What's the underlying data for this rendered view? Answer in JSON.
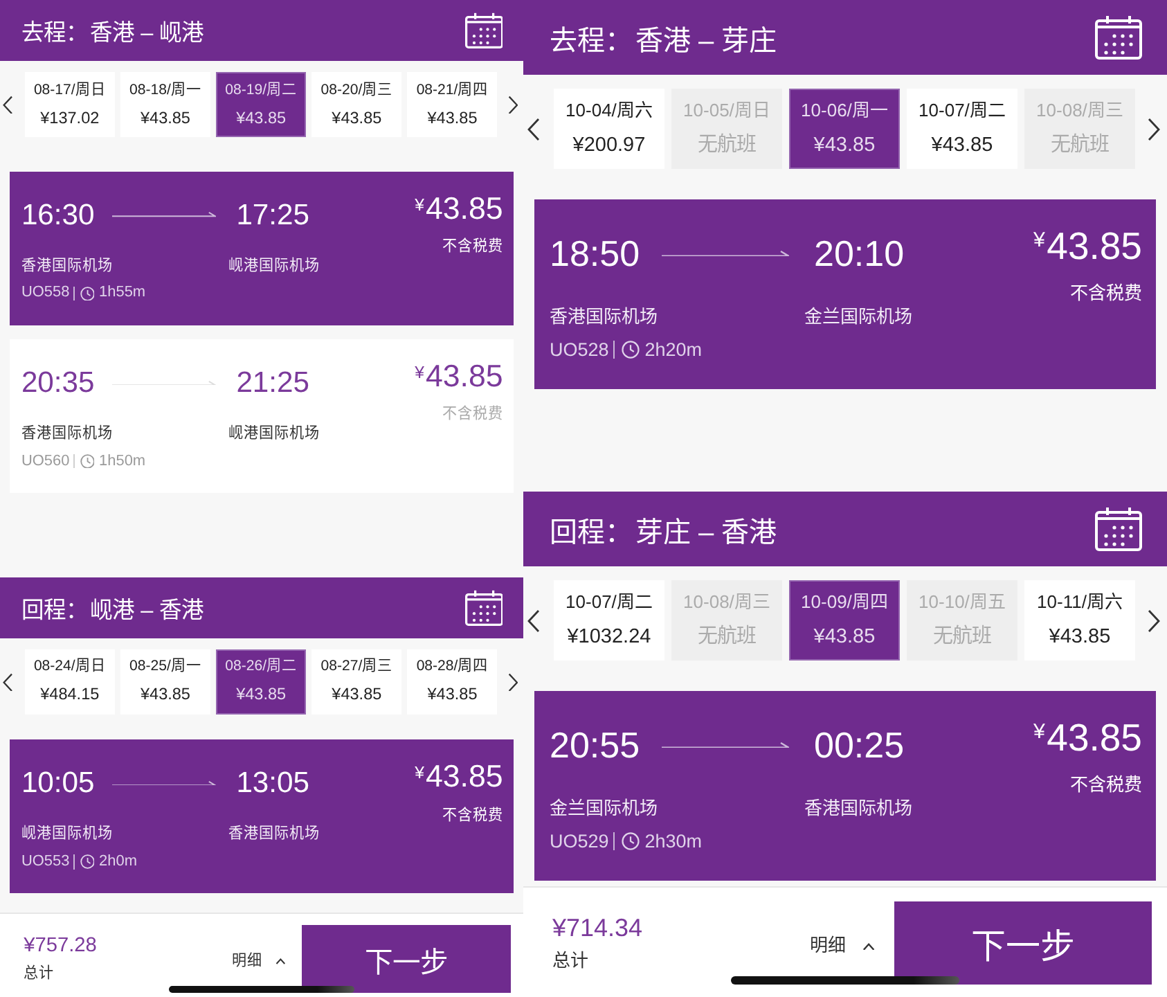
{
  "screens": [
    {
      "trips": [
        {
          "label": "去程：",
          "route": "香港 – 岘港",
          "dates": [
            {
              "date": "08-17/周日",
              "price": "¥137.02",
              "available": true,
              "selected": false
            },
            {
              "date": "08-18/周一",
              "price": "¥43.85",
              "available": true,
              "selected": false
            },
            {
              "date": "08-19/周二",
              "price": "¥43.85",
              "available": true,
              "selected": true
            },
            {
              "date": "08-20/周三",
              "price": "¥43.85",
              "available": true,
              "selected": false
            },
            {
              "date": "08-21/周四",
              "price": "¥43.85",
              "available": true,
              "selected": false
            }
          ],
          "flights": [
            {
              "depart": "16:30",
              "arrive": "17:25",
              "price": "$^{¥}$43.85",
              "tax_note": "不含税费",
              "from": "香港国际机场",
              "to": "岘港国际机场",
              "flight_no": "UO558",
              "duration": "1h55m",
              "selected": true
            },
            {
              "depart": "20:35",
              "arrive": "21:25",
              "price": "$^{¥}$43.85",
              "tax_note": "不含税费",
              "from": "香港国际机场",
              "to": "岘港国际机场",
              "flight_no": "UO560",
              "duration": "1h50m",
              "selected": false
            }
          ]
        },
        {
          "label": "回程：",
          "route": "岘港 – 香港",
          "dates": [
            {
              "date": "08-24/周日",
              "price": "¥484.15",
              "available": true,
              "selected": false
            },
            {
              "date": "08-25/周一",
              "price": "¥43.85",
              "available": true,
              "selected": false
            },
            {
              "date": "08-26/周二",
              "price": "¥43.85",
              "available": true,
              "selected": true
            },
            {
              "date": "08-27/周三",
              "price": "¥43.85",
              "available": true,
              "selected": false
            },
            {
              "date": "08-28/周四",
              "price": "¥43.85",
              "available": true,
              "selected": false
            }
          ],
          "flights": [
            {
              "depart": "10:05",
              "arrive": "13:05",
              "price": "$^{¥}$43.85",
              "tax_note": "不含税费",
              "from": "岘港国际机场",
              "to": "香港国际机场",
              "flight_no": "UO553",
              "duration": "2h0m",
              "selected": true
            }
          ]
        }
      ],
      "footer": {
        "total": "¥757.28",
        "total_label": "总计",
        "details": "明细",
        "next": "下一步"
      }
    },
    {
      "trips": [
        {
          "label": "去程：",
          "route": "香港 – 芽庄",
          "dates": [
            {
              "date": "10-04/周六",
              "price": "¥200.97",
              "available": true,
              "selected": false
            },
            {
              "date": "10-05/周日",
              "price": "无航班",
              "available": false,
              "selected": false
            },
            {
              "date": "10-06/周一",
              "price": "¥43.85",
              "available": true,
              "selected": true
            },
            {
              "date": "10-07/周二",
              "price": "¥43.85",
              "available": true,
              "selected": false
            },
            {
              "date": "10-08/周三",
              "price": "无航班",
              "available": false,
              "selected": false
            }
          ],
          "flights": [
            {
              "depart": "18:50",
              "arrive": "20:10",
              "price": "$^{¥}$43.85",
              "tax_note": "不含税费",
              "from": "香港国际机场",
              "to": "金兰国际机场",
              "flight_no": "UO528",
              "duration": "2h20m",
              "selected": true
            }
          ]
        },
        {
          "label": "回程：",
          "route": "芽庄 – 香港",
          "dates": [
            {
              "date": "10-07/周二",
              "price": "¥1032.24",
              "available": true,
              "selected": false
            },
            {
              "date": "10-08/周三",
              "price": "无航班",
              "available": false,
              "selected": false
            },
            {
              "date": "10-09/周四",
              "price": "¥43.85",
              "available": true,
              "selected": true
            },
            {
              "date": "10-10/周五",
              "price": "无航班",
              "available": false,
              "selected": false
            },
            {
              "date": "10-11/周六",
              "price": "¥43.85",
              "available": true,
              "selected": false
            }
          ],
          "flights": [
            {
              "depart": "20:55",
              "arrive": "00:25",
              "price": "$^{¥}$43.85",
              "tax_note": "不含税费",
              "from": "金兰国际机场",
              "to": "香港国际机场",
              "flight_no": "UO529",
              "duration": "2h30m",
              "selected": true
            }
          ]
        }
      ],
      "footer": {
        "total": "¥714.34",
        "total_label": "总计",
        "details": "明细",
        "next": "下一步"
      }
    }
  ]
}
